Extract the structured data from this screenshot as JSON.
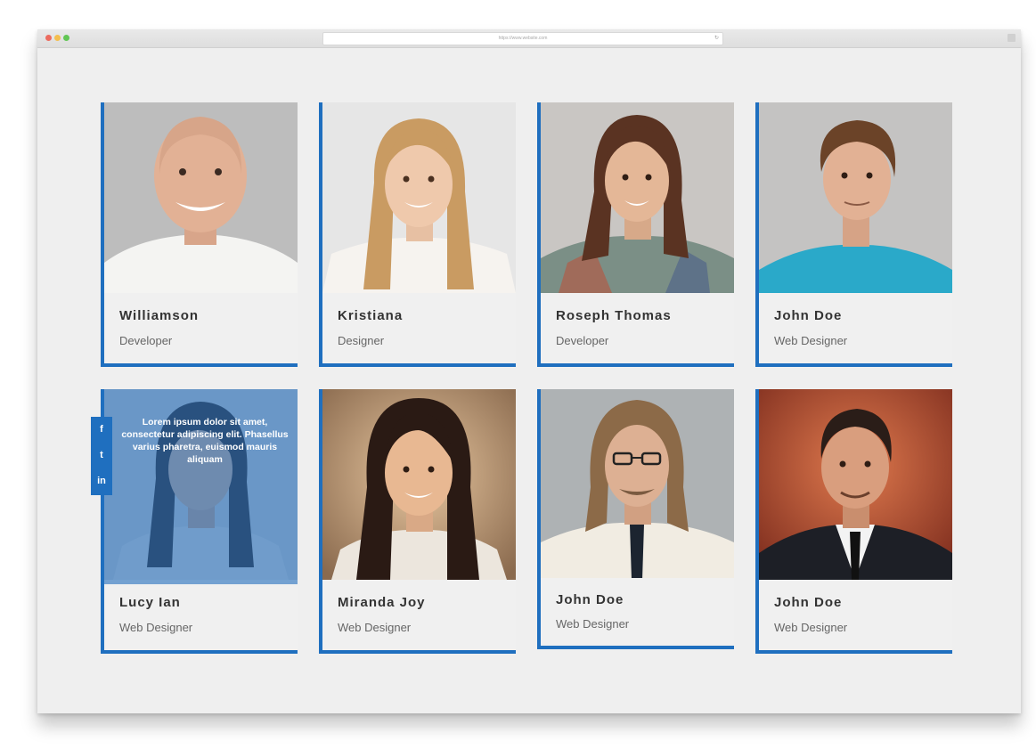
{
  "browser": {
    "url": "https://www.website.com"
  },
  "accent_color": "#1f6fbf",
  "team": [
    {
      "name": "Williamson",
      "role": "Developer",
      "avatar": "bald-man-white-shirt"
    },
    {
      "name": "Kristiana",
      "role": "Designer",
      "avatar": "blonde-woman"
    },
    {
      "name": "Roseph Thomas",
      "role": "Developer",
      "avatar": "brunette-woman-plaid"
    },
    {
      "name": "John Doe",
      "role": "Web Designer",
      "avatar": "man-teal-shirt"
    },
    {
      "name": "Lucy Ian",
      "role": "Web Designer",
      "avatar": "woman-hover-overlay",
      "overlay_text": "Lorem ipsum dolor sit amet, consectetur adipiscing elit. Phasellus varius pharetra, euismod mauris aliquam"
    },
    {
      "name": "Miranda Joy",
      "role": "Web Designer",
      "avatar": "dark-hair-woman"
    },
    {
      "name": "John Doe",
      "role": "Web Designer",
      "avatar": "man-glasses-tie"
    },
    {
      "name": "John Doe",
      "role": "Web Designer",
      "avatar": "man-suit"
    }
  ],
  "social_icons": [
    {
      "icon": "facebook-icon",
      "glyph": "f"
    },
    {
      "icon": "twitter-icon",
      "glyph": "t"
    },
    {
      "icon": "linkedin-icon",
      "glyph": "in"
    }
  ]
}
